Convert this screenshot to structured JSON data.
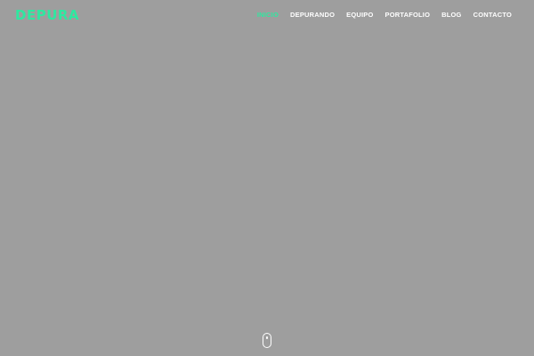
{
  "brand": {
    "logo_text": "DEPURA",
    "accent_color": "#2ee8a0",
    "dot_color": "#e8335a"
  },
  "nav": {
    "items": [
      {
        "label": "INICIO",
        "active": true
      },
      {
        "label": "DEPURANDO",
        "active": false
      },
      {
        "label": "EQUIPO",
        "active": false
      },
      {
        "label": "PORTAFOLIO",
        "active": false
      },
      {
        "label": "BLOG",
        "active": false
      },
      {
        "label": "CONTACTO",
        "active": false
      }
    ]
  },
  "hero": {
    "background_color": "#9e9e9e",
    "scroll_indicator_icon": "mouse-icon"
  }
}
